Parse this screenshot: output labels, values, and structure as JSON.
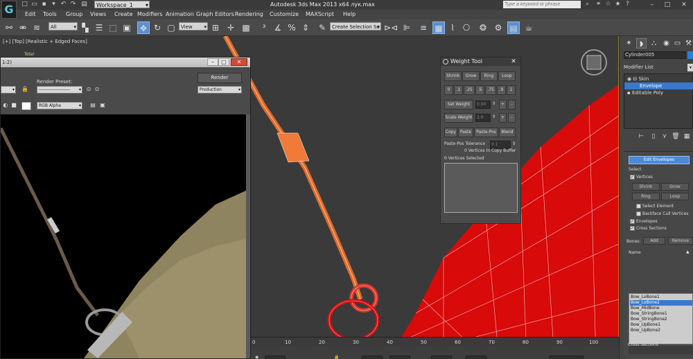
{
  "title_bar": {
    "workspace": "Workspace_1",
    "app_title": "Autodesk 3ds Max  2013 x64",
    "file_name": "лук.max",
    "search_placeholder": "Type a keyword or phrase"
  },
  "menu": [
    "Edit",
    "Tools",
    "Group",
    "Views",
    "Create",
    "Modifiers",
    "Animation",
    "Graph Editors",
    "Rendering",
    "Customize",
    "MAXScript",
    "Help"
  ],
  "toolbar": {
    "selection_filter": "All",
    "reference_coord": "View",
    "named_selection": "Create Selection Se"
  },
  "viewport": {
    "label": "[+] [Top] [Realistic + Edged Faces]",
    "stats_label": "Total"
  },
  "render_window": {
    "title": "1:2)",
    "render_preset_label": "Render Preset:",
    "render_button": "Render",
    "preset_value": "---------------------",
    "production_value": "Production",
    "channel_value": "RGB Alpha"
  },
  "weight_tool": {
    "title": "Weight Tool",
    "row1": [
      "Shrink",
      "Grow",
      "Ring",
      "Loop"
    ],
    "row2": [
      "0",
      ".1",
      ".25",
      ".5",
      ".75",
      ".9",
      "1"
    ],
    "set_weight_label": "Set Weight",
    "set_weight_value": "0.90",
    "scale_weight_label": "Scale Weight",
    "scale_weight_value": "2.0",
    "row3": [
      "Copy",
      "Paste",
      "Paste-Pos",
      "Blend"
    ],
    "paste_pos_tolerance_label": "Paste-Pos Tolerance",
    "paste_pos_tolerance_value": "0.1",
    "copy_buffer_text": "0 Vertices In Copy Buffer",
    "selected_text": "0 Vertices Selected"
  },
  "command_panel": {
    "object_name": "Cylinder005",
    "object_color": "#2c7fd6",
    "modifier_list_label": "Modifier List",
    "stack": [
      "Skin",
      "Envelope",
      "Editable Poly"
    ],
    "edit_envelopes_button": "Edit Envelopes",
    "select_label": "Select",
    "vertices_label": "Vertices",
    "shrink": "Shrink",
    "grow": "Grow",
    "ring": "Ring",
    "loop": "Loop",
    "select_element": "Select Element",
    "backface_cull": "Backface Cull Vertices",
    "envelopes_label": "Envelopes",
    "cross_sections_label": "Cross Sections",
    "bones_label": "Bones:",
    "add_button": "Add",
    "remove_button": "Remove",
    "name_header": "Name",
    "bones": [
      "Bow_LoBone1",
      "Bow_LoBone2",
      "Bow_MidBone",
      "Bow_StringBone1",
      "Bow_StringBone2",
      "Bow_UpBone1",
      "Bow_UpBone2"
    ],
    "footer_label": "Cross Sections"
  },
  "timeline": {
    "ticks": [
      "0",
      "10",
      "20",
      "30",
      "40",
      "50",
      "60",
      "70",
      "80",
      "90",
      "100"
    ]
  },
  "colors": {
    "accent": "#3a79c9",
    "mesh_red": "#e01010",
    "string_orange": "#e06a2a"
  }
}
